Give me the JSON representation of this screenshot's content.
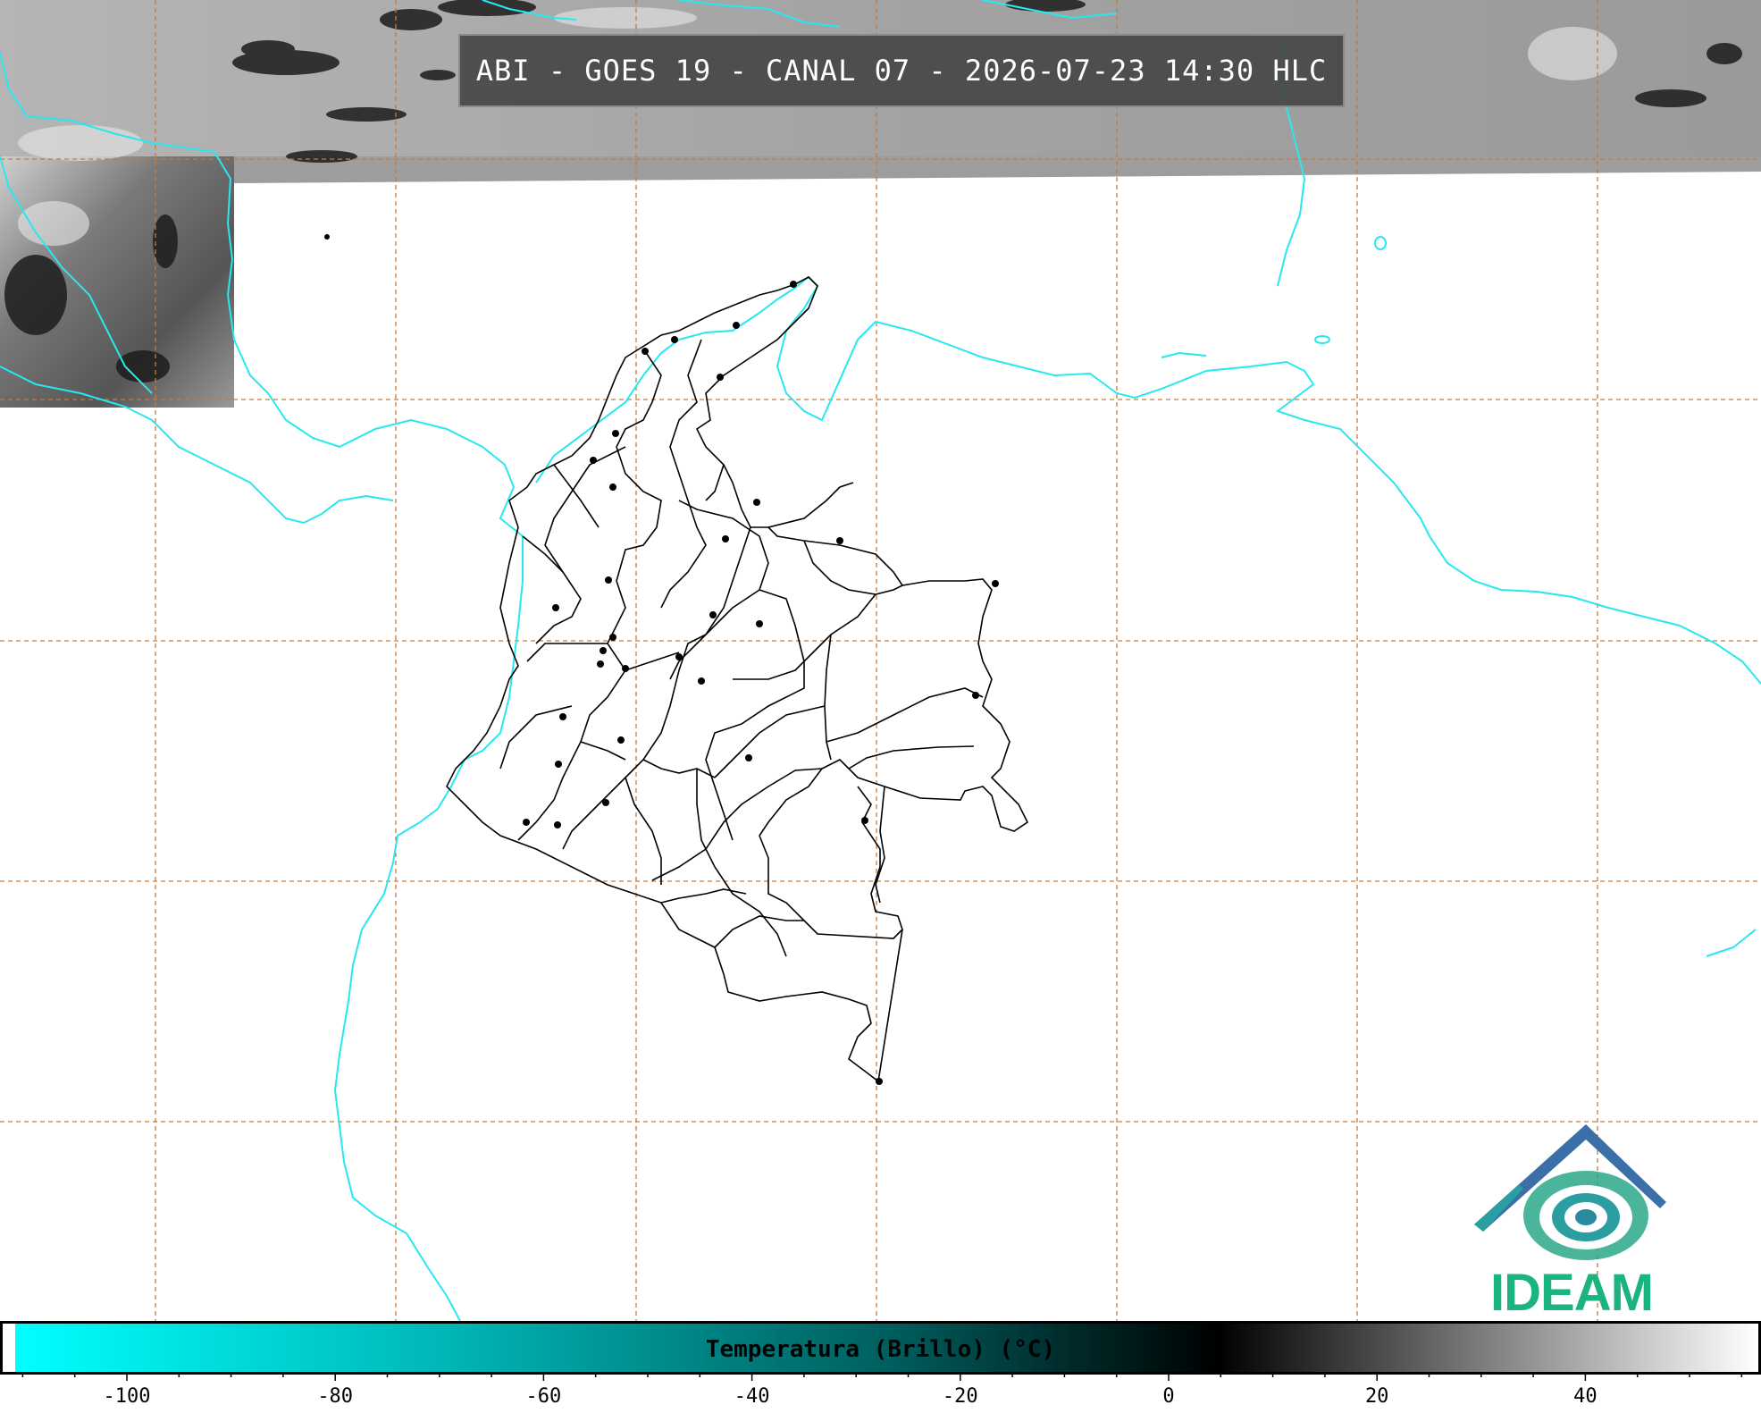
{
  "title": "ABI - GOES 19 - CANAL 07 - 2026-07-23 14:30 HLC",
  "colorbar": {
    "label": "Temperatura (Brillo) (°C)",
    "ticks": [
      "-100",
      "-80",
      "-60",
      "-40",
      "-20",
      "0",
      "20",
      "40"
    ],
    "range": [
      -110,
      56
    ],
    "colors": [
      "#00ffff",
      "#009090",
      "#000000",
      "#ffffff"
    ]
  },
  "logo": {
    "text": "IDEAM",
    "icon": "ideam-logo-icon",
    "color": "#1bb37e"
  },
  "map": {
    "coastline_color": "#27e8f0",
    "border_color": "#000000",
    "grid_color": "#c87a3c"
  }
}
